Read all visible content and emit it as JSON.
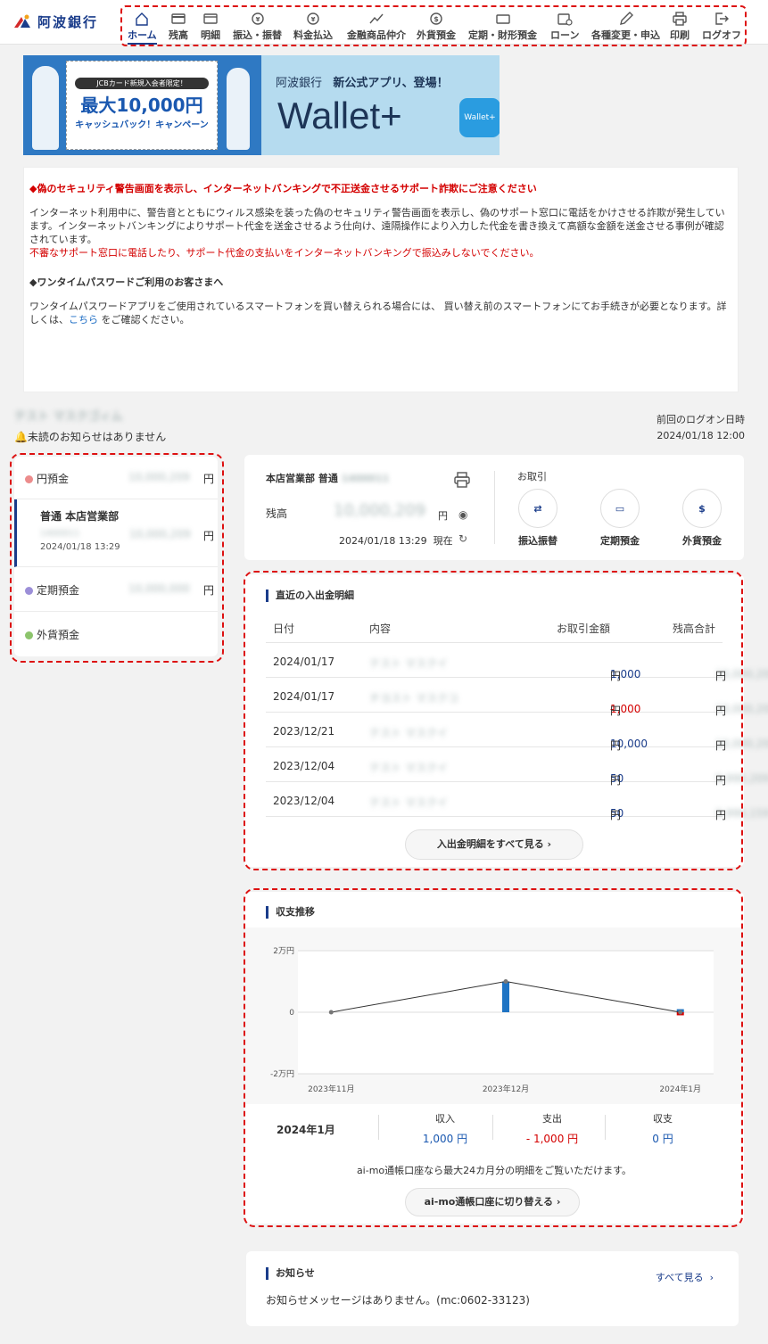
{
  "bank": {
    "name": "阿波銀行"
  },
  "nav": [
    {
      "label": "ホーム",
      "icon": "home-icon"
    },
    {
      "label": "残高",
      "icon": "card-icon"
    },
    {
      "label": "明細",
      "icon": "statement-icon"
    },
    {
      "label": "振込・振替",
      "icon": "transfer-icon"
    },
    {
      "label": "料金払込",
      "icon": "payeasy-icon"
    },
    {
      "label": "金融商品仲介",
      "icon": "chart-icon"
    },
    {
      "label": "外貨預金",
      "icon": "dollar-icon"
    },
    {
      "label": "定期・財形預金",
      "icon": "deposit-icon"
    },
    {
      "label": "ローン",
      "icon": "calendar-icon"
    },
    {
      "label": "各種変更・申込",
      "icon": "pencil-icon"
    },
    {
      "label": "印刷",
      "icon": "printer-icon"
    },
    {
      "label": "ログオフ",
      "icon": "logout-icon"
    }
  ],
  "banner": {
    "left_tag": "JCBカード新規入会者限定！",
    "left_amount": "最大10,000円",
    "left_sub": "キャッシュバック！キャンペーン",
    "right_top_1": "阿波銀行",
    "right_top_2": "新公式アプリ、登場！",
    "right_brand": "Wallet+",
    "right_icon": "Wallet+"
  },
  "notice": {
    "h1": "◆偽のセキュリティ警告画面を表示し、インターネットバンキングで不正送金させるサポート詐欺にご注意ください",
    "p1": "インターネット利用中に、警告音とともにウィルス感染を装った偽のセキュリティ警告画面を表示し、偽のサポート窓口に電話をかけさせる詐欺が発生しています。インターネットバンキングによりサポート代金を送金させるよう仕向け、遠隔操作により入力した代金を書き換えて高額な金額を送金させる事例が確認されています。",
    "p1_red": "不審なサポート窓口に電話したり、サポート代金の支払いをインターネットバンキングで振込みしないでください。",
    "h2": "◆ワンタイムパスワードご利用のお客さまへ",
    "p2_a": "ワンタイムパスワードアプリをご使用されているスマートフォンを買い替えられる場合には、 買い替え前のスマートフォンにてお手続きが必要となります。詳しくは、",
    "p2_link": "こちら",
    "p2_b": "をご確認ください。"
  },
  "user": {
    "name": "テスト マスクゴィム",
    "unread": "未読のお知らせはありません",
    "last_logon_label": "前回のログオン日時",
    "last_logon": "2024/01/18 12:00"
  },
  "accounts": {
    "yen": {
      "label": "円預金",
      "amount": "10,000,209",
      "unit": "円"
    },
    "selected": {
      "title": "普通 本店営業部",
      "number": "1400011",
      "amount": "10,000,209",
      "unit": "円",
      "time": "2024/01/18 13:29"
    },
    "fixed": {
      "label": "定期預金",
      "amount": "10,000,000",
      "unit": "円"
    },
    "foreign": {
      "label": "外貨預金"
    }
  },
  "summary": {
    "account": "本店営業部 普通",
    "account_no": "1400011",
    "balance_label": "残高",
    "balance": "10,000,209",
    "unit": "円",
    "time": "2024/01/18 13:29",
    "time_suffix": "現在",
    "tx_label": "お取引",
    "actions": [
      {
        "label": "振込振替",
        "icon": "transfer-icon"
      },
      {
        "label": "定期預金",
        "icon": "deposit-icon"
      },
      {
        "label": "外貨預金",
        "icon": "dollar-icon"
      }
    ]
  },
  "recent": {
    "title": "直近の入出金明細",
    "headers": [
      "日付",
      "内容",
      "お取引金額",
      "残高合計"
    ],
    "rows": [
      {
        "date": "2024/01/17",
        "desc": "テスト マスクイ",
        "amount": "1,000",
        "sign": "",
        "balance": "10,000,209"
      },
      {
        "date": "2024/01/17",
        "desc": "チヨスト マスクコ",
        "amount": "1,000",
        "sign": "- ",
        "balance": "10,000,209"
      },
      {
        "date": "2023/12/21",
        "desc": "テスト マスクイ",
        "amount": "10,000",
        "sign": "",
        "balance": "10,000,209"
      },
      {
        "date": "2023/12/04",
        "desc": "テスト マスクイ",
        "amount": "50",
        "sign": "",
        "balance": "9,990,209"
      },
      {
        "date": "2023/12/04",
        "desc": "テスト マスクイ",
        "amount": "50",
        "sign": "",
        "balance": "9,990,159"
      }
    ],
    "unit": "円",
    "more": "入出金明細をすべて見る"
  },
  "trend": {
    "title": "収支推移",
    "month": "2024年1月",
    "income_label": "収入",
    "income": "1,000 円",
    "expense_label": "支出",
    "expense": "- 1,000 円",
    "balance_label": "収支",
    "balance": "0 円",
    "note": "ai-mo通帳口座なら最大24カ月分の明細をご覧いただけます。",
    "switch": "ai-mo通帳口座に切り替える"
  },
  "chart_data": {
    "type": "bar",
    "categories": [
      "2023年11月",
      "2023年12月",
      "2024年1月"
    ],
    "series": [
      {
        "values": [
          0,
          10000,
          1000
        ]
      },
      {
        "values": [
          0,
          0,
          -1000
        ]
      },
      {
        "values": [
          0,
          10000,
          0
        ]
      }
    ],
    "ylim": [
      -20000,
      20000
    ],
    "yticks": [
      "2万円",
      "0",
      "-2万円"
    ],
    "grid": true,
    "colors": {
      "bar": "#1f74c4",
      "negative": "#d40000",
      "line": "#333333"
    }
  },
  "news": {
    "title": "お知らせ",
    "more": "すべて見る",
    "message": "お知らせメッセージはありません。(mc:0602-33123)"
  }
}
